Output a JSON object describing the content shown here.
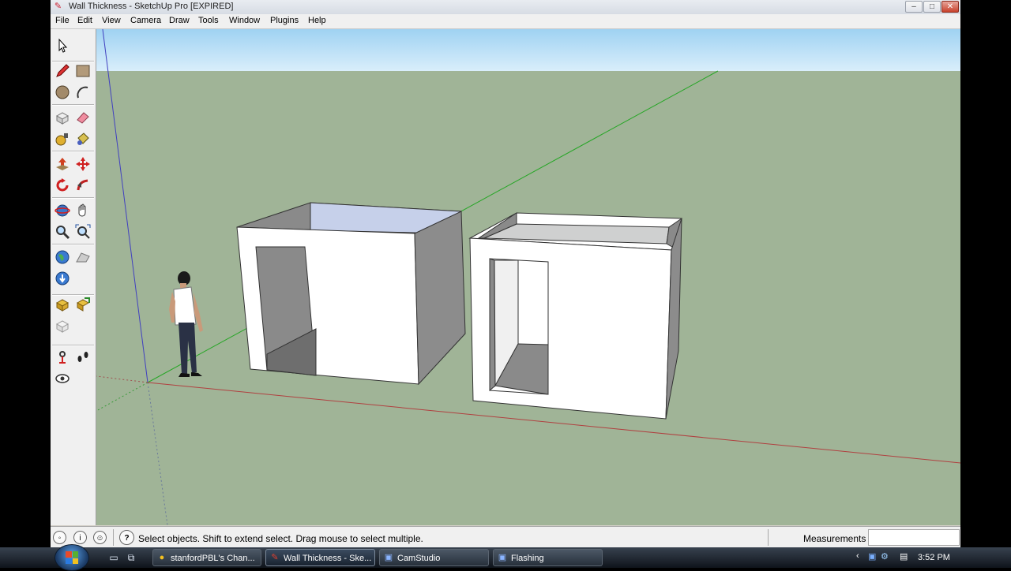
{
  "window": {
    "title": "Wall Thickness - SketchUp Pro [EXPIRED]",
    "buttons": [
      "–",
      "□",
      "✕"
    ]
  },
  "menu": {
    "items": [
      "File",
      "Edit",
      "View",
      "Camera",
      "Draw",
      "Tools",
      "Window",
      "Plugins",
      "Help"
    ]
  },
  "toolbar": {
    "tools": [
      {
        "name": "select-tool",
        "icon": "arrow-cursor-icon"
      },
      {
        "name": "pencil-tool",
        "icon": "pencil-icon"
      },
      {
        "name": "rectangle-tool",
        "icon": "rectangle-icon"
      },
      {
        "name": "circle-tool",
        "icon": "circle-icon"
      },
      {
        "name": "arc-tool",
        "icon": "arc-icon"
      },
      {
        "name": "make-component-tool",
        "icon": "component-icon"
      },
      {
        "name": "eraser-tool",
        "icon": "eraser-icon"
      },
      {
        "name": "tape-measure-tool",
        "icon": "tape-measure-icon"
      },
      {
        "name": "paint-bucket-tool",
        "icon": "paint-bucket-icon"
      },
      {
        "name": "push-pull-tool",
        "icon": "push-pull-icon"
      },
      {
        "name": "move-tool",
        "icon": "move-icon"
      },
      {
        "name": "rotate-tool",
        "icon": "rotate-icon"
      },
      {
        "name": "follow-me-tool",
        "icon": "follow-me-icon"
      },
      {
        "name": "orbit-tool",
        "icon": "orbit-icon"
      },
      {
        "name": "pan-tool",
        "icon": "pan-hand-icon"
      },
      {
        "name": "zoom-tool",
        "icon": "zoom-icon"
      },
      {
        "name": "zoom-extents-tool",
        "icon": "zoom-extents-icon"
      },
      {
        "name": "add-location-tool",
        "icon": "globe-icon"
      },
      {
        "name": "toggle-terrain-tool",
        "icon": "terrain-icon"
      },
      {
        "name": "get-models-tool",
        "icon": "globe-download-icon"
      },
      {
        "name": "share-model-tool",
        "icon": "share-model-icon"
      },
      {
        "name": "share-component-tool",
        "icon": "share-component-icon"
      },
      {
        "name": "photo-textures-tool",
        "icon": "photo-texture-icon"
      },
      {
        "name": "position-camera-tool",
        "icon": "position-camera-icon"
      },
      {
        "name": "walk-tool",
        "icon": "footprints-icon"
      },
      {
        "name": "look-around-tool",
        "icon": "eye-icon"
      }
    ]
  },
  "status": {
    "hint_icon": "?",
    "message": "Select objects. Shift to extend select. Drag mouse to select multiple.",
    "measurements_label": "Measurements",
    "measurements_value": ""
  },
  "taskbar": {
    "items": [
      {
        "label": "stanfordPBL's Chan...",
        "icon": "chrome-icon"
      },
      {
        "label": "Wall Thickness - Ske...",
        "icon": "sketchup-icon",
        "active": true
      },
      {
        "label": "CamStudio",
        "icon": "camstudio-icon"
      },
      {
        "label": "Flashing",
        "icon": "app-window-icon"
      }
    ],
    "time": "3:52 PM"
  },
  "colors": {
    "sky_top": "#9fd2f2",
    "sky_bottom": "#d9eefb",
    "ground": "#a0b497",
    "red_axis": "#b04040",
    "green_axis": "#26a626",
    "blue_axis": "#4040c0"
  }
}
